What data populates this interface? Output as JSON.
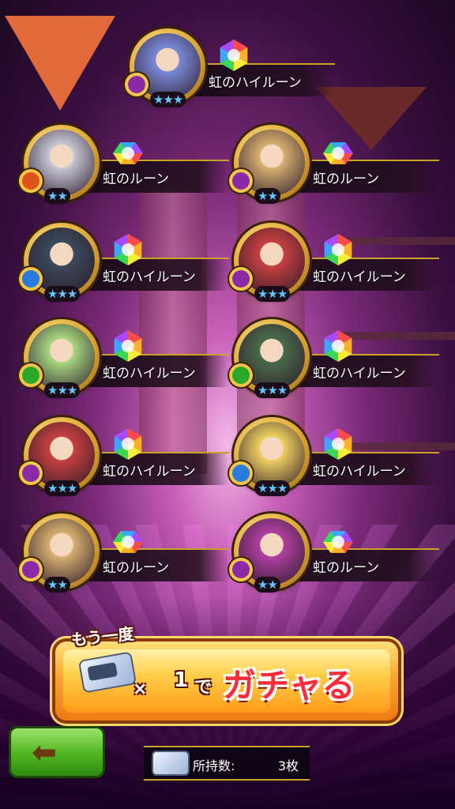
{
  "colors": {
    "rune_name_text": "#ffffff",
    "star_color": "#5ec8ff",
    "gacha_text": "#ff2a3a",
    "back_button": "#4fb520",
    "gold_frame": "#c9a227"
  },
  "results": [
    {
      "rune": "虹のハイルーン",
      "stars": "★★★",
      "element": "dark",
      "element_icon": "ribbon-icon",
      "rune_type": "high"
    },
    {
      "rune": "虹のルーン",
      "stars": "★★",
      "element": "fire",
      "element_icon": "crossbow-icon",
      "rune_type": "normal"
    },
    {
      "rune": "虹のルーン",
      "stars": "★★",
      "element": "dark",
      "element_icon": "staff-icon",
      "rune_type": "normal"
    },
    {
      "rune": "虹のハイルーン",
      "stars": "★★★",
      "element": "water",
      "element_icon": "claw-icon",
      "rune_type": "high"
    },
    {
      "rune": "虹のハイルーン",
      "stars": "★★★",
      "element": "dark",
      "element_icon": "ribbon-icon",
      "rune_type": "high"
    },
    {
      "rune": "虹のハイルーン",
      "stars": "★★★",
      "element": "wind",
      "element_icon": "claw-icon",
      "rune_type": "high"
    },
    {
      "rune": "虹のハイルーン",
      "stars": "★★★",
      "element": "wind",
      "element_icon": "sword-icon",
      "rune_type": "high"
    },
    {
      "rune": "虹のハイルーン",
      "stars": "★★★",
      "element": "dark",
      "element_icon": "axe-icon",
      "rune_type": "high"
    },
    {
      "rune": "虹のハイルーン",
      "stars": "★★★",
      "element": "water",
      "element_icon": "sword-icon",
      "rune_type": "high"
    },
    {
      "rune": "虹のルーン",
      "stars": "★★",
      "element": "dark",
      "element_icon": "staff-icon",
      "rune_type": "normal"
    },
    {
      "rune": "虹のルーン",
      "stars": "★★",
      "element": "dark",
      "element_icon": "staff-icon",
      "rune_type": "normal"
    }
  ],
  "gacha_button": {
    "again_label": "もう一度",
    "times_sign": "×",
    "count": "1",
    "de": "で",
    "action": "ガチャる"
  },
  "owned": {
    "label": "所持数:",
    "value": "3枚"
  },
  "back_button": {
    "icon": "left-arrow-icon"
  }
}
